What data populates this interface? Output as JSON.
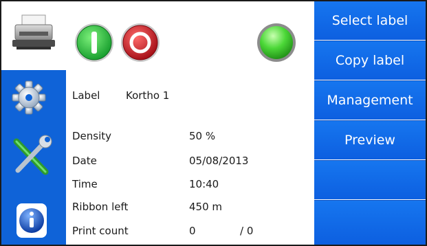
{
  "label_section": {
    "label_key": "Label",
    "label_value": "Kortho 1"
  },
  "info": [
    {
      "key": "Density",
      "value": "50 %"
    },
    {
      "key": "Date",
      "value": "05/08/2013"
    },
    {
      "key": "Time",
      "value": "10:40"
    },
    {
      "key": "Ribbon left",
      "value": "450 m"
    },
    {
      "key": "Print count",
      "value": "0",
      "value2": "/ 0"
    }
  ],
  "menu": [
    {
      "label": "Select label"
    },
    {
      "label": "Copy label"
    },
    {
      "label": "Management"
    },
    {
      "label": "Preview"
    },
    {
      "label": ""
    },
    {
      "label": ""
    }
  ],
  "icons": {
    "printer": "printer-icon",
    "start": "start-icon",
    "stop": "stop-icon",
    "status": "status-led-icon",
    "settings": "gear-icon",
    "tools": "tools-icon",
    "info": "info-icon"
  },
  "colors": {
    "menu_blue": "#1676ef",
    "nav_blue": "#0f63d8",
    "start_green": "#22b14c",
    "stop_red": "#c0141b",
    "status_green": "#4cd838"
  }
}
